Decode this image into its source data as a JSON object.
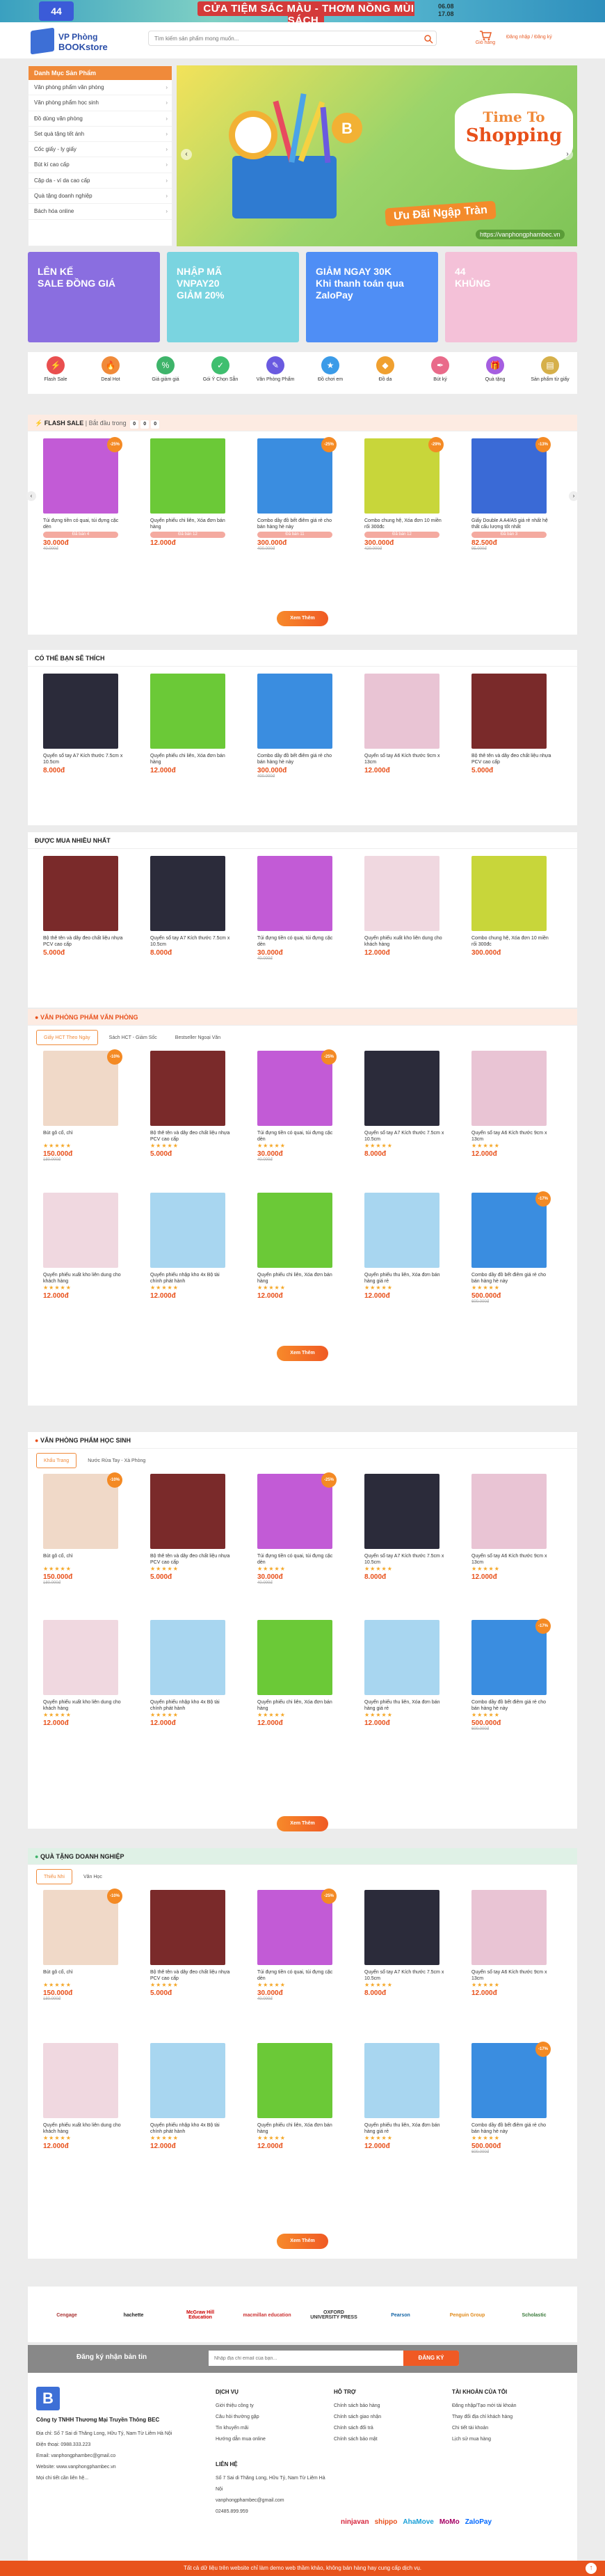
{
  "topbanner": {
    "pill": "44",
    "text": "CỬA TIỆM SẮC MÀU - THƠM NỒNG MÙI SÁCH",
    "date1": "06.08",
    "date2": "17.08"
  },
  "logo": {
    "line1": "VP Phòng",
    "line2": "BOOKstore"
  },
  "search": {
    "placeholder": "Tìm kiếm sản phẩm mong muốn..."
  },
  "cart": {
    "label": "Giỏ hàng"
  },
  "account": {
    "label": "Đăng nhập / Đăng ký"
  },
  "menu": {
    "title": "Danh Mục Sản Phẩm",
    "items": [
      "Văn phòng phẩm văn phòng",
      "Văn phòng phẩm học sinh",
      "Đồ dùng văn phòng",
      "Set quà tặng tết ánh",
      "Cốc giấy - ly giấy",
      "Bút kí cao cấp",
      "Cặp da - ví da cao cấp",
      "Quà tặng doanh nghiệp",
      "Bách hóa online"
    ]
  },
  "slider": {
    "line1": "Time To",
    "line2": "Shopping",
    "tag": "Ưu Đãi Ngập Tràn",
    "web": "https://vanphongphambec.vn"
  },
  "promos": [
    {
      "text": "LÊN KẾ\nSALE ĐỒNG GIÁ",
      "color": "#8a6ee0"
    },
    {
      "text": "NHẬP MÃ\nVNPAY20\nGIẢM 20%",
      "color": "#7ad4e0"
    },
    {
      "text": "GIẢM NGAY 30K\nKhi thanh toán qua ZaloPay",
      "color": "#4f8ef5"
    },
    {
      "text": "44\nKHỦNG",
      "color": "#f4c1d8"
    }
  ],
  "icons": [
    {
      "label": "Flash Sale",
      "c": "#e94f4f",
      "g": "⚡"
    },
    {
      "label": "Deal Hot",
      "c": "#f08a3a",
      "g": "🔥"
    },
    {
      "label": "Giá giảm giá",
      "c": "#3eb46a",
      "g": "%"
    },
    {
      "label": "Gói Ý Chọn Sẵn",
      "c": "#3fbf6f",
      "g": "✓"
    },
    {
      "label": "Văn Phòng Phẩm",
      "c": "#6a5ae0",
      "g": "✎"
    },
    {
      "label": "Đồ chơi em",
      "c": "#3b9be8",
      "g": "★"
    },
    {
      "label": "Đồ da",
      "c": "#f0a030",
      "g": "◆"
    },
    {
      "label": "Bút ký",
      "c": "#e96a8a",
      "g": "✒"
    },
    {
      "label": "Quà tặng",
      "c": "#a55ee0",
      "g": "🎁"
    },
    {
      "label": "Sản phẩm từ giấy",
      "c": "#d6b04a",
      "g": "▤"
    }
  ],
  "flash": {
    "title": "FLASH SALE",
    "sub": "| Bắt đầu trong",
    "time": [
      "0",
      "0",
      "0"
    ],
    "items": [
      {
        "name": "Túi đựng tiền có quai, túi đựng cặc dèn",
        "price": "30.000đ",
        "old": "40.000đ",
        "bar": "Đã bán 4",
        "c": "#c25bd6",
        "d": "-25%"
      },
      {
        "name": "Quyển phiếu chi liên, Xóa đơn bán hàng",
        "price": "12.000đ",
        "old": "",
        "bar": "Đã bán 12",
        "c": "#6bc937",
        "d": ""
      },
      {
        "name": "Combo dầy đồ bết điêm giá rẻ cho bán hàng hè này",
        "price": "300.000đ",
        "old": "400.000đ",
        "bar": "Đã bán 11",
        "c": "#3a8de0",
        "d": "-25%"
      },
      {
        "name": "Combo chung hệ, Xóa đơn 10 miền rối 300đc",
        "price": "300.000đ",
        "old": "420.000đ",
        "bar": "Đã bán 12",
        "c": "#c8d63a",
        "d": "-29%"
      },
      {
        "name": "Giấy Double A A4/A5 giá rẻ nhất hệ thất cấu lượng tốt nhất",
        "price": "82.500đ",
        "old": "95.000đ",
        "bar": "Đã bán 3",
        "c": "#3a6ad6",
        "d": "-13%"
      }
    ],
    "more": "Xem Thêm"
  },
  "sec2": {
    "title": "CÓ THỂ BẠN SẼ THÍCH",
    "items": [
      {
        "name": "Quyển sổ tay A7 Kích thước 7.5cm x 10.5cm",
        "price": "8.000đ",
        "old": "",
        "c": "#2b2b3a"
      },
      {
        "name": "Quyển phiếu chi liên, Xóa đơn bán hàng",
        "price": "12.000đ",
        "old": "",
        "c": "#6bc937"
      },
      {
        "name": "Combo dầy đồ bết điêm giá rẻ cho bán hàng hè này",
        "price": "300.000đ",
        "old": "400.000đ",
        "c": "#3a8de0"
      },
      {
        "name": "Quyển sổ tay A6 Kích thước 9cm x 13cm",
        "price": "12.000đ",
        "old": "",
        "c": "#e9c4d4"
      },
      {
        "name": "Bộ thê tên và dây đeo chất liệu nhựa PCV cao cấp",
        "price": "5.000đ",
        "old": "",
        "c": "#7a2a2a"
      }
    ]
  },
  "sec3": {
    "title": "ĐƯỢC MUA NHIỀU NHẤT",
    "items": [
      {
        "name": "Bộ thê tên và dây đeo chất liệu nhựa PCV cao cấp",
        "price": "5.000đ",
        "old": "",
        "c": "#7a2a2a"
      },
      {
        "name": "Quyển sổ tay A7 Kích thước 7.5cm x 10.5cm",
        "price": "8.000đ",
        "old": "",
        "c": "#2b2b3a"
      },
      {
        "name": "Túi đựng tiền có quai, túi đựng cặc dèn",
        "price": "30.000đ",
        "old": "40.000đ",
        "c": "#c25bd6"
      },
      {
        "name": "Quyển phiếu xuất kho liên dung cho khách hàng",
        "price": "12.000đ",
        "old": "",
        "c": "#f0d8e0"
      },
      {
        "name": "Combo chung hệ, Xóa đơn 10 miền rối 300đc",
        "price": "300.000đ",
        "old": "",
        "c": "#c8d63a"
      }
    ]
  },
  "sec4": {
    "title": "VĂN PHÒNG PHẨM VĂN PHÒNG",
    "tabs": [
      "Giấy HCT Theo Ngày",
      "Sách HCT - Giảm Sốc",
      "Bestseller Ngoại Văn"
    ],
    "more": "Xem Thêm"
  },
  "sec5": {
    "title": "VĂN PHÒNG PHẨM HỌC SINH",
    "tabs": [
      "Khẩu Trang",
      "Nước Rửa Tay - Xà Phòng"
    ],
    "more": "Xem Thêm"
  },
  "sec6": {
    "title": "QUÀ TẶNG DOANH NGHIỆP",
    "tabs": [
      "Thiếu Nhi",
      "Văn Học"
    ],
    "more": "Xem Thêm"
  },
  "grid": [
    {
      "name": "Bút gỗ cổ, chì",
      "price": "150.000đ",
      "old": "180.000đ",
      "c": "#f0d9c8",
      "d": "-10%"
    },
    {
      "name": "Bộ thê tên và dây đeo chất liệu nhựa PCV cao cấp",
      "price": "5.000đ",
      "old": "",
      "c": "#7a2a2a",
      "d": ""
    },
    {
      "name": "Túi đựng tiền có quai, túi đựng cặc dèn",
      "price": "30.000đ",
      "old": "40.000đ",
      "c": "#c25bd6",
      "d": "-25%"
    },
    {
      "name": "Quyển sổ tay A7 Kích thước 7.5cm x 10.5cm",
      "price": "8.000đ",
      "old": "",
      "c": "#2b2b3a",
      "d": ""
    },
    {
      "name": "Quyển sổ tay A6 Kích thước 9cm x 13cm",
      "price": "12.000đ",
      "old": "",
      "c": "#e9c4d4",
      "d": ""
    },
    {
      "name": "Quyển phiếu xuất kho liên dung cho khách hàng",
      "price": "12.000đ",
      "old": "",
      "c": "#f0d8e0",
      "d": ""
    },
    {
      "name": "Quyển phiếu nhập kho 4x Bộ tài chính phát hành",
      "price": "12.000đ",
      "old": "",
      "c": "#a8d6f0",
      "d": ""
    },
    {
      "name": "Quyển phiếu chi liên, Xóa đơn bán hàng",
      "price": "12.000đ",
      "old": "",
      "c": "#6bc937",
      "d": ""
    },
    {
      "name": "Quyển phiếu thu liên, Xóa đơn bán hàng giá rẻ",
      "price": "12.000đ",
      "old": "",
      "c": "#a8d6f0",
      "d": ""
    },
    {
      "name": "Combo dầy đồ bết điêm giá rẻ cho bán hàng hè này",
      "price": "500.000đ",
      "old": "600.000đ",
      "c": "#3a8de0",
      "d": "-17%"
    }
  ],
  "brands": [
    "Cengage",
    "hachette",
    "McGraw Hill Education",
    "macmillan education",
    "OXFORD UNIVERSITY PRESS",
    "Pearson",
    "Penguin Group",
    "Scholastic"
  ],
  "newsletter": {
    "label": "Đăng ký nhận bản tin",
    "placeholder": "Nhập địa chỉ email của bạn...",
    "button": "ĐĂNG KÝ"
  },
  "footer": {
    "company": "Công ty TNHH Thương Mại Truyền Thông BEC",
    "address": "Địa chỉ: Số 7 Sai di Thăng Long, Hữu Tý, Nam Từ Liêm Hà Nội",
    "phone": "Điện thoại: 0988.333.223",
    "email": "Email: vanphongphambec@gmail.co",
    "website": "Website: www.vanphongphambec.vn",
    "note": "Mọi chi tiết cần liên hệ...",
    "c1": {
      "title": "DỊCH VỤ",
      "items": [
        "Giới thiệu công ty",
        "Câu hỏi thường gặp",
        "Tin khuyến mãi",
        "Hướng dẫn mua online"
      ]
    },
    "c2": {
      "title": "HỖ TRỢ",
      "items": [
        "Chính sách bảo hàng",
        "Chính sách giao nhận",
        "Chính sách đổi trả",
        "Chính sách bảo mật"
      ]
    },
    "c3": {
      "title": "TÀI KHOẢN CỦA TÔI",
      "items": [
        "Đăng nhập/Tạo mới tài khoản",
        "Thay đổi địa chỉ khách hàng",
        "Chi tiết tài khoản",
        "Lịch sử mua hàng"
      ]
    },
    "c4": {
      "title": "LIÊN HỆ",
      "items": [
        "Số 7 Sai di Thăng Long, Hữu Tý, Nam Từ Liêm Hà Nội",
        "vanphongphambec@gmail.com",
        "02485.899.959"
      ]
    },
    "pays": [
      "ninjavan",
      "shippo",
      "AhaMove",
      "MoMo",
      "ZaloPay"
    ]
  },
  "bottom": "Tất cả dữ liệu trên website chỉ làm demo web thầm khảo, không bán hàng hay cung cấp dịch vụ."
}
